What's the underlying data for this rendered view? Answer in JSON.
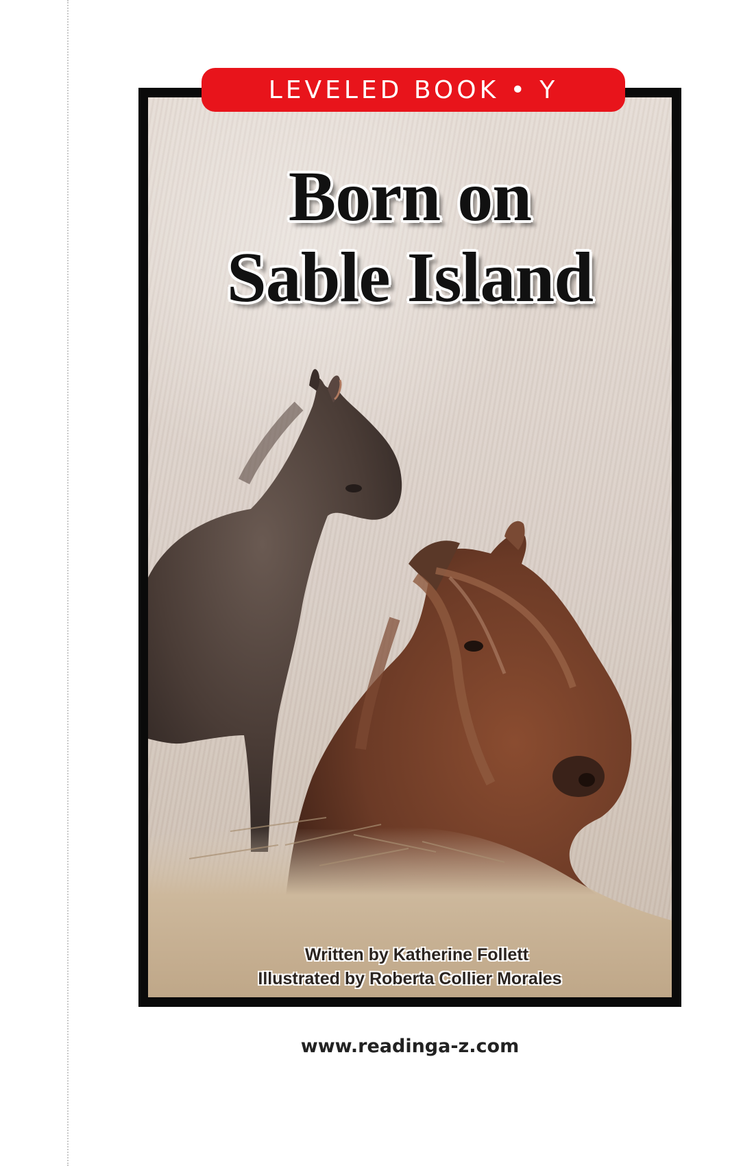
{
  "badge": {
    "label": "LEVELED BOOK • Y",
    "color": "#e8141b"
  },
  "title": {
    "line1": "Born on",
    "line2": "Sable Island"
  },
  "credits": {
    "writer": "Written by Katherine Follett",
    "illustrator": "Illustrated by Roberta Collier Morales"
  },
  "footer": {
    "url": "www.readinga-z.com"
  },
  "colors": {
    "frame": "#0a0a0a",
    "foal": "#4a3c36",
    "mare": "#6b3a26",
    "grass": "#d9cec6"
  }
}
